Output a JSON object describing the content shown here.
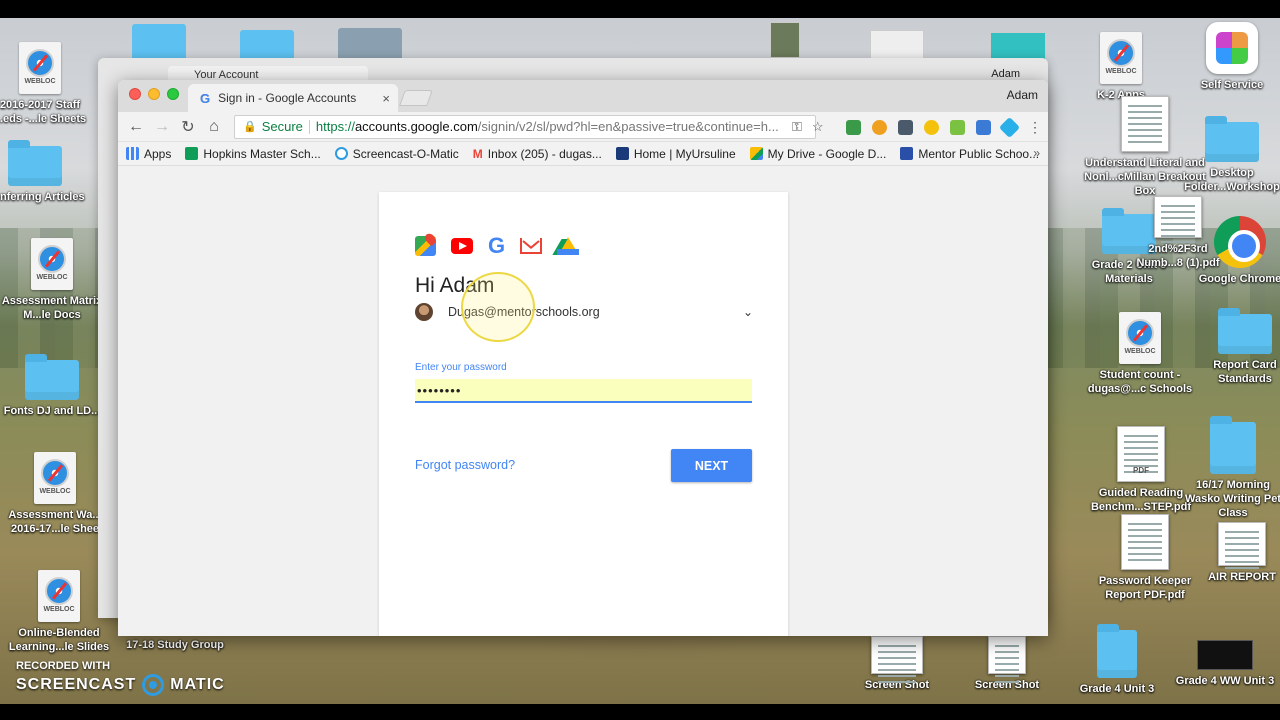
{
  "desktop": {
    "left_icons": [
      {
        "label": "2016-2017 Staff ...eds -...le Sheets",
        "kind": "webloc"
      },
      {
        "label": "Conferring Articles",
        "kind": "folder"
      },
      {
        "label": "Assessment Matrix M...le Docs",
        "kind": "webloc"
      },
      {
        "label": "Fonts DJ and LD...",
        "kind": "folder"
      },
      {
        "label": "Assessment Wa... 2016-17...le Shee",
        "kind": "webloc"
      },
      {
        "label": "Online-Blended Learning...le Slides",
        "kind": "webloc"
      }
    ],
    "right_icons": [
      {
        "label": "K-2 Apps",
        "kind": "webloc"
      },
      {
        "label": "Self Service",
        "kind": "app"
      },
      {
        "label": "Understand Literal and Nonl...cMillan Breakout Box",
        "kind": "doc"
      },
      {
        "label": "Desktop Folder...Workshop",
        "kind": "folder"
      },
      {
        "label": "Grade 2 Unit 3 Materials",
        "kind": "folder"
      },
      {
        "label": "2nd%2F3rd Numb...8 (1).pdf",
        "kind": "doc"
      },
      {
        "label": "Google Chrome",
        "kind": "chrome"
      },
      {
        "label": "Student count - dugas@...c Schools",
        "kind": "webloc"
      },
      {
        "label": "Report Card Standards",
        "kind": "folder"
      },
      {
        "label": "Guided Reading Benchm...STEP.pdf",
        "kind": "pdf"
      },
      {
        "label": "16/17 Morning Wasko Writing Pet Class",
        "kind": "folder"
      },
      {
        "label": "Password Keeper Report PDF.pdf",
        "kind": "doc"
      },
      {
        "label": "AIR REPORT",
        "kind": "doc"
      }
    ],
    "bottom_labels": [
      "17-18 Study Group",
      "Screen Shot",
      "Screen Shot",
      "Grade 4 Unit 3",
      "Grade 4 WW Unit 3"
    ],
    "watermark_small": "RECORDED WITH",
    "watermark_left": "SCREENCAST",
    "watermark_right": "MATIC"
  },
  "bg_window": {
    "tab_title": "Your Account",
    "user": "Adam"
  },
  "window": {
    "user": "Adam",
    "tab": {
      "title": "Sign in - Google Accounts",
      "close": "×"
    },
    "url": {
      "secure_label": "Secure",
      "scheme": "https://",
      "host": "accounts.google.com",
      "path": "/signin/v2/sl/pwd?hl=en&passive=true&continue=h..."
    },
    "bookmarks": [
      {
        "label": "Apps",
        "color": "#4285f4"
      },
      {
        "label": "Hopkins Master Sch...",
        "color": "#0f9d58"
      },
      {
        "label": "Screencast-O-Matic",
        "color": "#2f9be0"
      },
      {
        "label": "Inbox (205) - dugas...",
        "color": "#ea4335"
      },
      {
        "label": "Home | MyUrsuline",
        "color": "#1a3a7a"
      },
      {
        "label": "My Drive - Google D...",
        "color": "#fbbc05"
      },
      {
        "label": "Mentor Public Schoo...",
        "color": "#2a4fa8"
      }
    ],
    "bookmarks_more": "»"
  },
  "signin": {
    "greeting": "Hi Adam",
    "email": "Dugas@mentorschools.org",
    "password_label": "Enter your password",
    "password_value": "••••••••",
    "forgot_label": "Forgot password?",
    "next_label": "NEXT"
  },
  "colors": {
    "accent": "#4285f4",
    "secure_green": "#0b8043",
    "autofill_yellow": "#faffbd"
  }
}
